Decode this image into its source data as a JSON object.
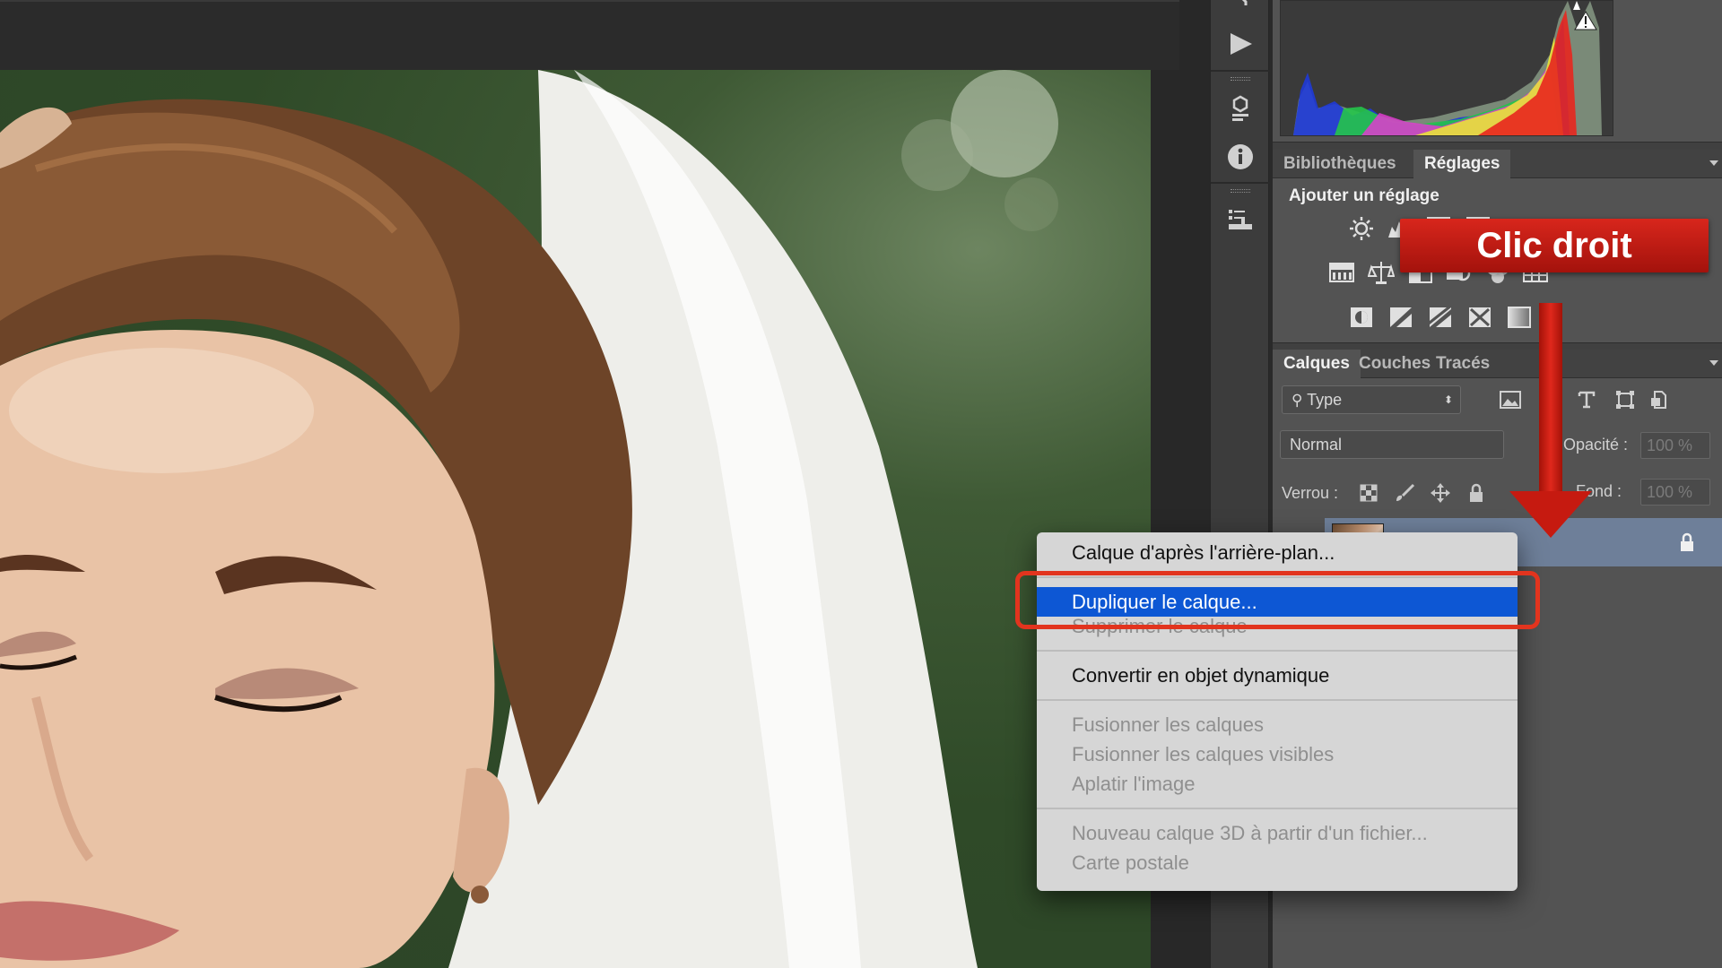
{
  "panels": {
    "top_tabs": [
      "Bibliothèques",
      "Réglages"
    ],
    "adjustments_title": "Ajouter un réglage",
    "layers_tabs": [
      "Calques",
      "Couches",
      "Tracés"
    ],
    "filter_placeholder": "Type",
    "blend_mode": "Normal",
    "opacity_label": "Opacité :",
    "opacity_value": "100 %",
    "lock_label": "Verrou :",
    "fill_label": "Fond :",
    "fill_value": "100 %"
  },
  "annotation": {
    "label": "Clic droit",
    "color": "#d8261c"
  },
  "context_menu": {
    "groups": [
      [
        {
          "label": "Calque d'après l'arrière-plan...",
          "state": "enabled"
        }
      ],
      [
        {
          "label": "Dupliquer le calque...",
          "state": "highlighted"
        },
        {
          "label": "Supprimer le calque",
          "state": "disabled"
        }
      ],
      [
        {
          "label": "Convertir en objet dynamique",
          "state": "enabled"
        }
      ],
      [
        {
          "label": "Fusionner les calques",
          "state": "disabled"
        },
        {
          "label": "Fusionner les calques visibles",
          "state": "disabled"
        },
        {
          "label": "Aplatir l'image",
          "state": "disabled"
        }
      ],
      [
        {
          "label": "Nouveau calque 3D à partir d'un fichier...",
          "state": "disabled"
        },
        {
          "label": "Carte postale",
          "state": "disabled"
        }
      ]
    ],
    "highlight_color": "#0d57d4"
  },
  "icons": {
    "strip": [
      "history-icon",
      "play-action-icon",
      "3d-icon",
      "info-icon",
      "properties-icon"
    ],
    "adjustments": [
      "brightness-contrast-icon",
      "levels-icon",
      "curves-icon",
      "exposure-icon",
      "vibrance-icon",
      "hue-saturation-icon",
      "color-balance-icon",
      "black-white-icon",
      "photo-filter-icon",
      "channel-mixer-icon",
      "color-lookup-icon",
      "invert-icon",
      "posterize-icon",
      "threshold-icon",
      "selective-color-icon",
      "gradient-map-icon"
    ]
  }
}
